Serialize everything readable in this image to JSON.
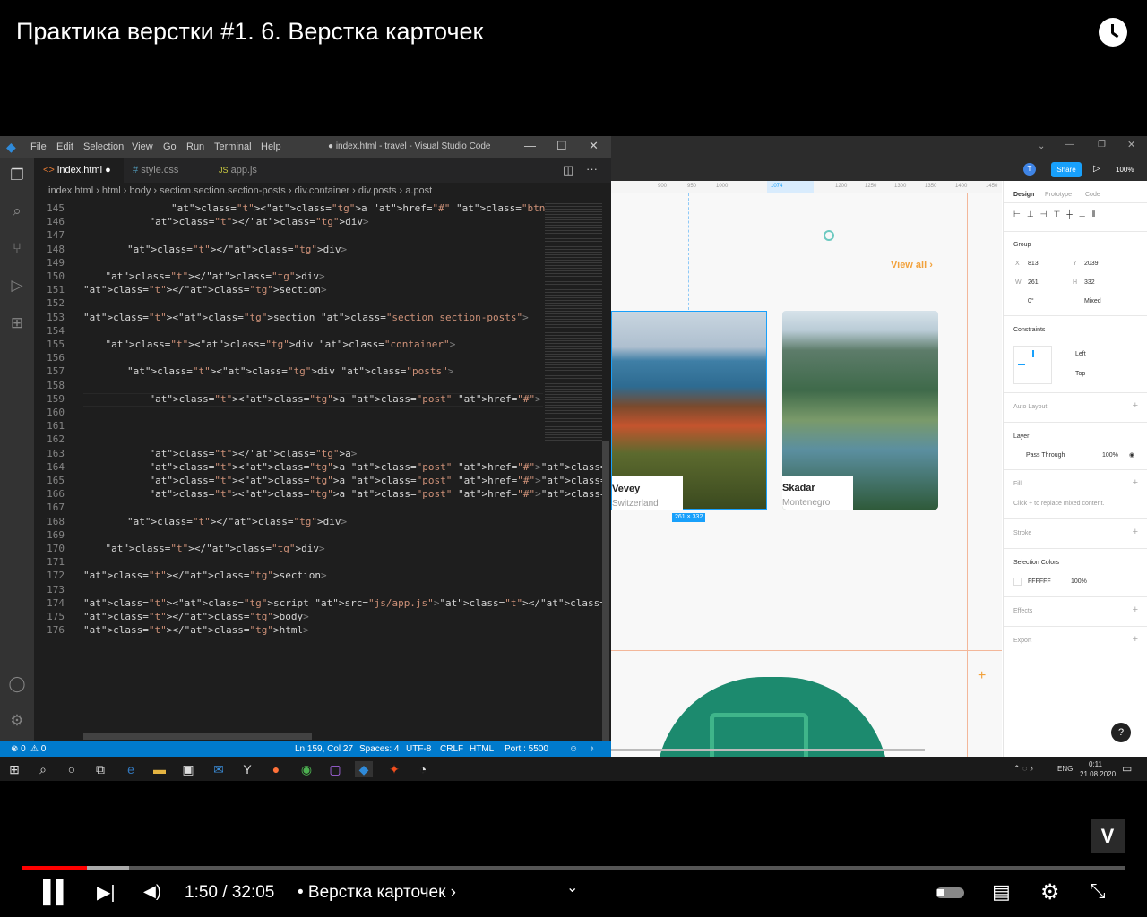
{
  "video": {
    "title": "Практика верстки #1. 6. Верстка карточек",
    "time": "1:50 / 32:05",
    "chapter": "• Верстка карточек"
  },
  "vscode": {
    "menu": [
      "File",
      "Edit",
      "Selection",
      "View",
      "Go",
      "Run",
      "Terminal",
      "Help"
    ],
    "window_title": "● index.html - travel - Visual Studio Code",
    "tabs": [
      {
        "label": "index.html",
        "icon": "<>"
      },
      {
        "label": "style.css",
        "icon": "#"
      },
      {
        "label": "app.js",
        "icon": "JS"
      }
    ],
    "breadcrumb": [
      "index.html",
      "html",
      "body",
      "section.section.section-posts",
      "div.container",
      "div.posts",
      "a.post"
    ],
    "lines": [
      "145",
      "146",
      "147",
      "148",
      "149",
      "150",
      "151",
      "152",
      "153",
      "154",
      "155",
      "156",
      "157",
      "158",
      "159",
      "160",
      "161",
      "162",
      "163",
      "164",
      "165",
      "166",
      "167",
      "168",
      "169",
      "170",
      "171",
      "172",
      "173",
      "174",
      "175",
      "176"
    ],
    "status": {
      "errors": "⊗ 0",
      "warnings": "⚠ 0",
      "position": "Ln 159, Col 27",
      "spaces": "Spaces: 4",
      "encoding": "UTF-8",
      "eol": "CRLF",
      "lang": "HTML",
      "port": "Port : 5500"
    }
  },
  "figma": {
    "share": "Share",
    "zoom": "100%",
    "avatar": "T",
    "ruler": [
      "900",
      "950",
      "1000",
      "1074",
      "1200",
      "1250",
      "1300",
      "1350",
      "1400",
      "1450"
    ],
    "view_all": "View all",
    "cards": [
      {
        "title": "Vevey",
        "subtitle": "Switzerland"
      },
      {
        "title": "Skadar",
        "subtitle": "Montenegro"
      }
    ],
    "size_label": "261 × 332",
    "panel": {
      "tabs": [
        "Design",
        "Prototype",
        "Code"
      ],
      "group": "Group",
      "x": "813",
      "y": "2039",
      "w": "261",
      "h": "332",
      "rot": "0°",
      "radius": "Mixed",
      "constraints": "Constraints",
      "left": "Left",
      "top": "Top",
      "auto_layout": "Auto Layout",
      "layer": "Layer",
      "pass": "Pass Through",
      "opacity": "100%",
      "fill": "Fill",
      "fill_hint": "Click + to replace mixed content.",
      "stroke": "Stroke",
      "selection_colors": "Selection Colors",
      "color": "FFFFFF",
      "color_op": "100%",
      "effects": "Effects",
      "export": "Export"
    }
  },
  "taskbar": {
    "lang": "ENG",
    "time": "0:11",
    "date": "21.08.2020"
  },
  "colors": {
    "vs_blue": "#007acc",
    "figma_blue": "#18a0fb",
    "accent_orange": "#f2a23c"
  }
}
